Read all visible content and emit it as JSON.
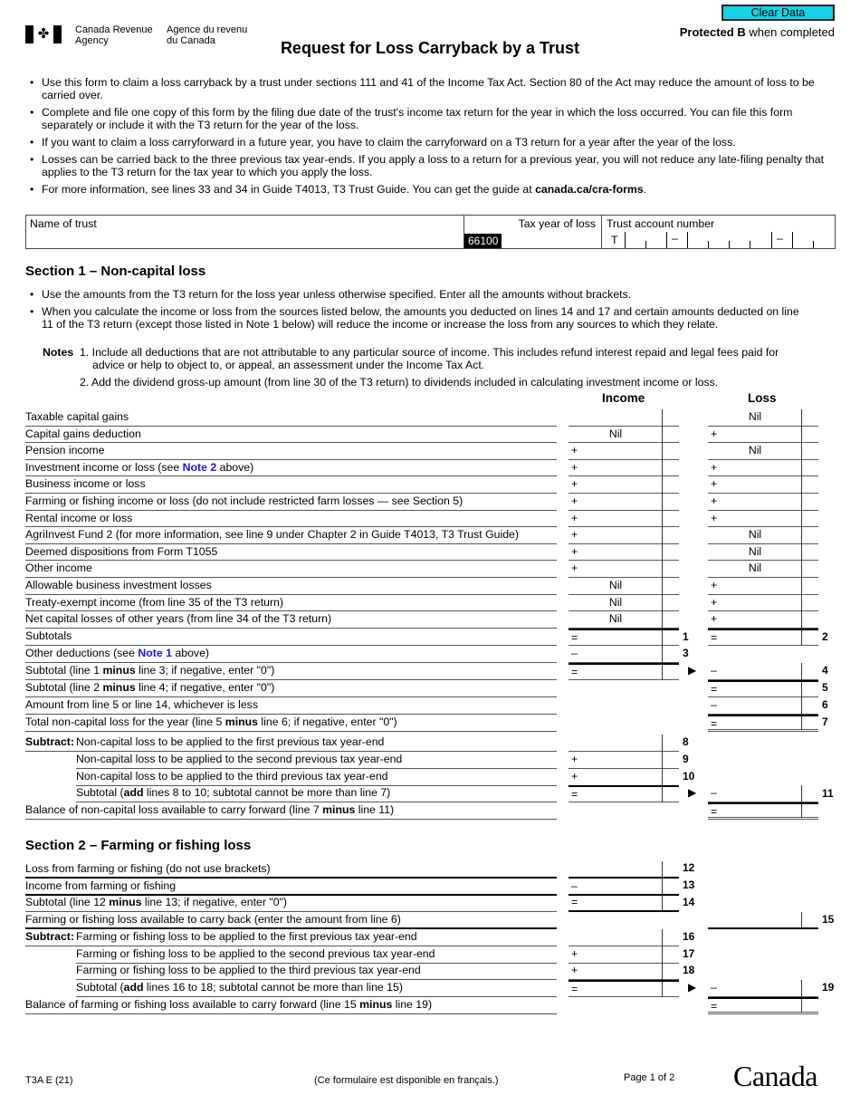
{
  "header": {
    "agency_en_line1": "Canada Revenue",
    "agency_en_line2": "Agency",
    "agency_fr_line1": "Agence du revenu",
    "agency_fr_line2": "du Canada",
    "title": "Request for Loss Carryback by a Trust",
    "clear_button": "Clear Data",
    "protected_bold": "Protected B",
    "protected_rest": " when completed"
  },
  "intro_bullets": [
    "Use this form to claim a loss carryback by a trust under sections 111 and 41 of the Income Tax Act. Section 80 of the Act may reduce the amount of loss to be carried over.",
    "Complete and file one copy of this form by the filing due date of the trust's income tax return for the year in which the loss occurred. You can file this form separately or include it with the T3 return for the year of the loss.",
    "If you want to claim a loss carryforward in a future year, you have to claim the carryforward on a T3 return for a year after the year of the loss.",
    "Losses can be carried back to the three previous tax year-ends. If you apply a loss to a return for a previous year, you will not reduce any late-filing penalty that applies to the T3 return for the tax year to which you apply the loss."
  ],
  "intro_last_bullet": {
    "text": "For more information, see lines 33 and 34 in Guide T4013, T3 Trust Guide. You can get the guide at ",
    "link": "canada.ca/cra-forms",
    "end": "."
  },
  "info": {
    "name_label": "Name of trust",
    "name_value": "",
    "tax_year_label": "Tax year of loss",
    "tax_year_code": "66100",
    "tax_year_value": "",
    "account_label": "Trust account number",
    "account_prefix": "T",
    "dash": "–"
  },
  "section1": {
    "heading": "Section 1 – Non-capital loss",
    "bullets": [
      "Use the amounts from the T3 return for the loss year unless otherwise specified. Enter all the amounts without brackets.",
      "When you calculate the income or loss from the sources listed below, the amounts you deducted on lines 14 and 17 and certain amounts deducted on line 11 of the T3 return (except those listed in Note 1 below) will reduce the income or increase the loss from any sources to which they relate."
    ],
    "notes_label": "Notes",
    "note1": "1. Include all deductions that are not attributable to any particular source of income. This includes refund interest repaid and legal fees paid for advice or help to object to, or appeal, an assessment under the Income Tax Act.",
    "note2": "2. Add the dividend gross-up amount (from line 30 of the T3 return) to dividends included in calculating investment income or loss.",
    "col_income": "Income",
    "col_loss": "Loss",
    "rows": [
      {
        "label": "Taxable capital gains",
        "inc_op": "",
        "inc_nil": "",
        "loss_op": "",
        "loss_nil": "Nil"
      },
      {
        "label": "Capital gains deduction",
        "inc_op": "",
        "inc_nil": "Nil",
        "loss_op": "+",
        "loss_nil": ""
      },
      {
        "label": "Pension income",
        "inc_op": "+",
        "inc_nil": "",
        "loss_op": "",
        "loss_nil": "Nil"
      },
      {
        "label_pre": "Investment income or loss (see ",
        "label_link": "Note 2",
        "label_post": " above)",
        "inc_op": "+",
        "inc_nil": "",
        "loss_op": "+",
        "loss_nil": ""
      },
      {
        "label": "Business income or loss",
        "inc_op": "+",
        "inc_nil": "",
        "loss_op": "+",
        "loss_nil": ""
      },
      {
        "label": "Farming or fishing income or loss (do not include restricted farm losses — see Section 5)",
        "inc_op": "+",
        "inc_nil": "",
        "loss_op": "+",
        "loss_nil": ""
      },
      {
        "label": "Rental income or loss",
        "inc_op": "+",
        "inc_nil": "",
        "loss_op": "+",
        "loss_nil": ""
      },
      {
        "label": "AgriInvest Fund 2 (for more information, see line 9 under Chapter 2 in Guide T4013, T3 Trust Guide)",
        "inc_op": "+",
        "inc_nil": "",
        "loss_op": "",
        "loss_nil": "Nil"
      },
      {
        "label": "Deemed dispositions from Form T1055",
        "inc_op": "+",
        "inc_nil": "",
        "loss_op": "",
        "loss_nil": "Nil"
      },
      {
        "label": "Other income",
        "inc_op": "+",
        "inc_nil": "",
        "loss_op": "",
        "loss_nil": "Nil"
      },
      {
        "label": "Allowable business investment losses",
        "inc_op": "",
        "inc_nil": "Nil",
        "loss_op": "+",
        "loss_nil": ""
      },
      {
        "label": "Treaty-exempt income (from line 35 of the T3 return)",
        "inc_op": "",
        "inc_nil": "Nil",
        "loss_op": "+",
        "loss_nil": ""
      },
      {
        "label": "Net capital losses of other years (from line 34 of the T3 return)",
        "inc_op": "",
        "inc_nil": "Nil",
        "loss_op": "+",
        "loss_nil": ""
      }
    ],
    "subtotals": {
      "label": "Subtotals",
      "inc_op": "=",
      "inc_line": "1",
      "loss_op": "=",
      "loss_line": "2"
    },
    "other_deductions": {
      "label_pre": "Other deductions (see ",
      "label_link": "Note 1",
      "label_post": " above)",
      "op": "–",
      "line": "3"
    },
    "line4": {
      "pre": "Subtotal (line 1 ",
      "bold": "minus",
      "post": " line 3; if negative, enter \"0\")",
      "inc_op": "=",
      "loss_op": "–",
      "line": "4"
    },
    "line5": {
      "pre": "Subtotal (line 2 ",
      "bold": "minus",
      "post": " line 4; if negative, enter \"0\")",
      "op": "=",
      "line": "5"
    },
    "line6": {
      "label": "Amount from line 5 or line 14, whichever is less",
      "op": "–",
      "line": "6"
    },
    "line7": {
      "pre": "Total non-capital loss for the year (line 5 ",
      "bold": "minus",
      "post": " line 6; if negative, enter \"0\")",
      "op": "=",
      "line": "7"
    },
    "subtract_label": "Subtract:",
    "line8": {
      "label": "Non-capital loss to be applied to the first previous tax year-end",
      "op": "",
      "line": "8"
    },
    "line9": {
      "label": "Non-capital loss to be applied to the second previous tax year-end",
      "op": "+",
      "line": "9"
    },
    "line10": {
      "label": "Non-capital loss to be applied to the third previous tax year-end",
      "op": "+",
      "line": "10"
    },
    "line11": {
      "pre": "Subtotal (",
      "bold": "add",
      "post": " lines 8 to 10; subtotal cannot be more than line 7)",
      "inc_op": "=",
      "loss_op": "–",
      "line": "11"
    },
    "balance": {
      "pre": "Balance of non-capital loss available to carry forward (line 7 ",
      "bold": "minus",
      "post": " line 11)",
      "op": "="
    }
  },
  "section2": {
    "heading": "Section 2 – Farming or fishing loss",
    "line12": {
      "label": "Loss from farming or fishing (do not use brackets)",
      "op": "",
      "line": "12"
    },
    "line13": {
      "label": "Income from farming or fishing",
      "op": "–",
      "line": "13"
    },
    "line14": {
      "pre": "Subtotal (line 12 ",
      "bold": "minus",
      "post": " line 13; if negative, enter \"0\")",
      "op": "=",
      "line": "14"
    },
    "line15": {
      "label": "Farming or fishing loss available to carry back (enter the amount from line 6)",
      "line": "15"
    },
    "subtract_label": "Subtract:",
    "line16": {
      "label": "Farming or fishing loss to be applied to the first previous tax year-end",
      "op": "",
      "line": "16"
    },
    "line17": {
      "label": "Farming or fishing loss to be applied to the second previous tax year-end",
      "op": "+",
      "line": "17"
    },
    "line18": {
      "label": "Farming or fishing loss to be applied to the third previous tax year-end",
      "op": "+",
      "line": "18"
    },
    "line19": {
      "pre": "Subtotal (",
      "bold": "add",
      "post": " lines 16 to 18; subtotal cannot be more than line 15)",
      "inc_op": "=",
      "loss_op": "–",
      "line": "19"
    },
    "balance": {
      "pre": "Balance of farming or fishing loss available to carry forward (line 15 ",
      "bold": "minus",
      "post": " line 19)",
      "op": "="
    }
  },
  "footer": {
    "form_id": "T3A E (21)",
    "french_note": "(Ce formulaire est disponible en français.)",
    "page": "Page 1 of 2",
    "wordmark": "Canada"
  },
  "icons": {
    "arrow": "▶",
    "leaf": "✤"
  }
}
